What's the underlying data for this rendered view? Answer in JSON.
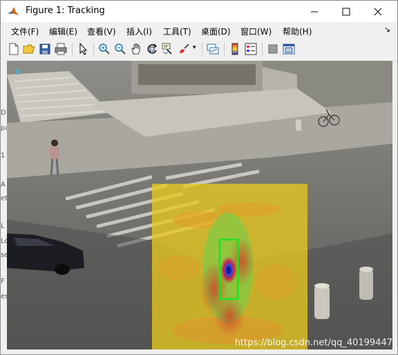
{
  "window": {
    "title": "Figure 1: Tracking"
  },
  "menu": [
    "文件(F)",
    "编辑(E)",
    "查看(V)",
    "插入(I)",
    "工具(T)",
    "桌面(D)",
    "窗口(W)",
    "帮助(H)"
  ],
  "menu_overflow_icon": "arrow-icon",
  "toolbar": [
    "new-figure-icon",
    "open-file-icon",
    "save-icon",
    "print-icon",
    "pointer-icon",
    "zoom-in-icon",
    "zoom-out-icon",
    "pan-icon",
    "rotate-3d-icon",
    "data-cursor-icon",
    "brush-icon",
    "link-plot-icon",
    "colorbar-icon",
    "legend-icon",
    "hide-plot-tools-icon",
    "show-plot-tools-icon"
  ],
  "figure": {
    "frame_number": "6",
    "watermark": "https://blog.csdn.net/qq_40199447",
    "tracking_box_color": "#22e022",
    "response_map_color": "#e8c81e"
  },
  "left_strip_glyphs": [
    "D",
    "pa",
    "1",
    "A",
    "et",
    "L",
    "Lo",
    "se",
    "F",
    "es"
  ]
}
